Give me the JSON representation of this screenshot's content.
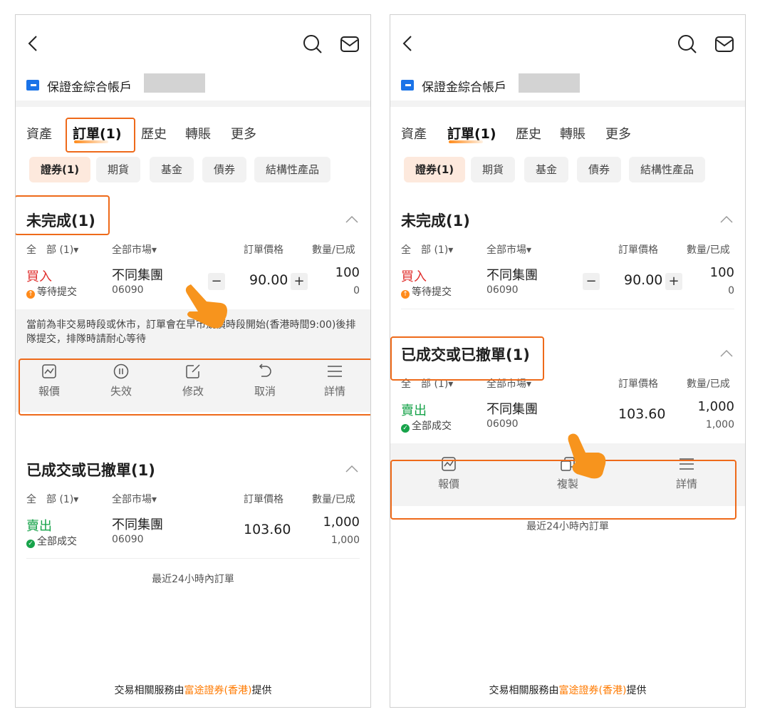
{
  "colors": {
    "accent": "#ff7a00",
    "highlight_border": "#ee6a1a",
    "buy": "#e0302e",
    "sell": "#17a34a",
    "chip_active_bg": "#fde9dd"
  },
  "icons": [
    "back-arrow-icon",
    "search-icon",
    "mail-icon",
    "account-icon",
    "chevron-up-icon",
    "chart-icon",
    "pause-icon",
    "edit-icon",
    "undo-icon",
    "menu-icon",
    "copy-icon",
    "tap-hand-icon"
  ],
  "left": {
    "account_name": "保證金綜合帳戶",
    "tabs": [
      "資產",
      "訂單(1)",
      "歷史",
      "轉賬",
      "更多"
    ],
    "chips": [
      "證券(1)",
      "期貨",
      "基金",
      "債券",
      "結構性產品"
    ],
    "pending": {
      "title": "未完成(1)",
      "cols": [
        "全　部 (1)▾",
        "全部市場▾",
        "訂單價格",
        "數量/已成"
      ],
      "order": {
        "side": "買入",
        "status": "等待提交",
        "name": "不同集團",
        "code": "06090",
        "minus": "−",
        "price": "90.00",
        "plus": "+",
        "qty": "100",
        "filled": "0"
      },
      "notice": "當前為非交易時段或休市，訂單會在早市競價時段開始(香港時間9:00)後排隊提交，排隊時請耐心等待",
      "actions": [
        "報價",
        "失效",
        "修改",
        "取消",
        "詳情"
      ]
    },
    "done": {
      "title": "已成交或已撤單(1)",
      "cols": [
        "全　部 (1)▾",
        "全部市場▾",
        "訂單價格",
        "數量/已成"
      ],
      "order": {
        "side": "賣出",
        "status": "全部成交",
        "name": "不同集團",
        "code": "06090",
        "price": "103.60",
        "qty": "1,000",
        "filled": "1,000"
      },
      "footnote": "最近24小時內訂單"
    },
    "credit_prefix": "交易相關服務由",
    "credit_brand": "富途證券(香港)",
    "credit_suffix": "提供"
  },
  "right": {
    "account_name": "保證金綜合帳戶",
    "tabs": [
      "資產",
      "訂單(1)",
      "歷史",
      "轉賬",
      "更多"
    ],
    "chips": [
      "證券(1)",
      "期貨",
      "基金",
      "債券",
      "結構性產品"
    ],
    "pending": {
      "title": "未完成(1)",
      "cols": [
        "全　部 (1)▾",
        "全部市場▾",
        "訂單價格",
        "數量/已成"
      ],
      "order": {
        "side": "買入",
        "status": "等待提交",
        "name": "不同集團",
        "code": "06090",
        "minus": "−",
        "price": "90.00",
        "plus": "+",
        "qty": "100",
        "filled": "0"
      }
    },
    "done": {
      "title": "已成交或已撤單(1)",
      "cols": [
        "全　部 (1)▾",
        "全部市場▾",
        "訂單價格",
        "數量/已成"
      ],
      "order": {
        "side": "賣出",
        "status": "全部成交",
        "name": "不同集團",
        "code": "06090",
        "price": "103.60",
        "qty": "1,000",
        "filled": "1,000"
      },
      "actions": [
        "報價",
        "複製",
        "詳情"
      ],
      "footnote": "最近24小時內訂單"
    },
    "credit_prefix": "交易相關服務由",
    "credit_brand": "富途證券(香港)",
    "credit_suffix": "提供"
  }
}
